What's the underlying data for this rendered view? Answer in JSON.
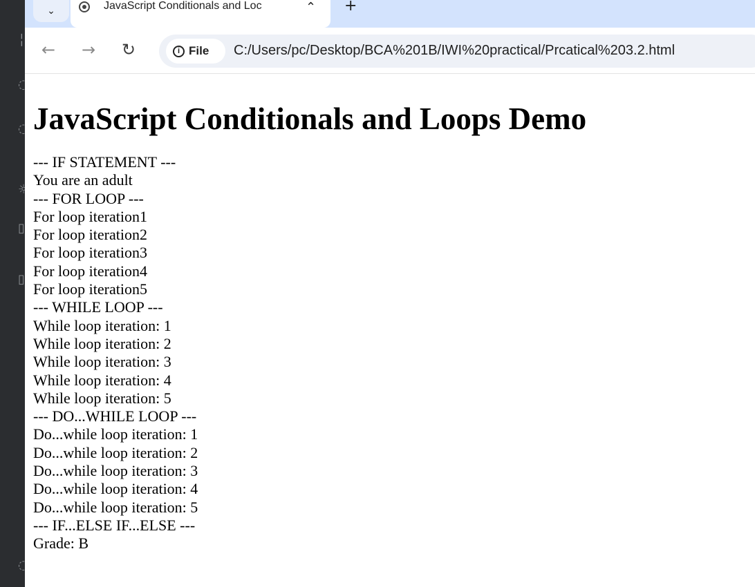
{
  "browser": {
    "tab": {
      "search_icon": "chevron-down-icon",
      "title": "JavaScript Conditionals and Loc",
      "favicon": "globe-icon"
    },
    "toolbar": {
      "site_info_label": "File",
      "url": "C:/Users/pc/Desktop/BCA%201B/IWI%20practical/Prcatical%203.2.html"
    }
  },
  "page": {
    "heading": "JavaScript Conditionals and Loops Demo",
    "output_lines": [
      "--- IF STATEMENT ---",
      "You are an adult",
      "--- FOR LOOP ---",
      "For loop iteration1",
      "For loop iteration2",
      "For loop iteration3",
      "For loop iteration4",
      "For loop iteration5",
      "--- WHILE LOOP ---",
      "While loop iteration: 1",
      "While loop iteration: 2",
      "While loop iteration: 3",
      "While loop iteration: 4",
      "While loop iteration: 5",
      "--- DO...WHILE LOOP ---",
      "Do...while loop iteration: 1",
      "Do...while loop iteration: 2",
      "Do...while loop iteration: 3",
      "Do...while loop iteration: 4",
      "Do...while loop iteration: 5",
      "--- IF...ELSE IF...ELSE ---",
      "Grade: B"
    ]
  },
  "colors": {
    "tabstrip": "#d3e3fd",
    "omnibox": "#eef1f7",
    "editor_strip": "#2b2d30"
  }
}
